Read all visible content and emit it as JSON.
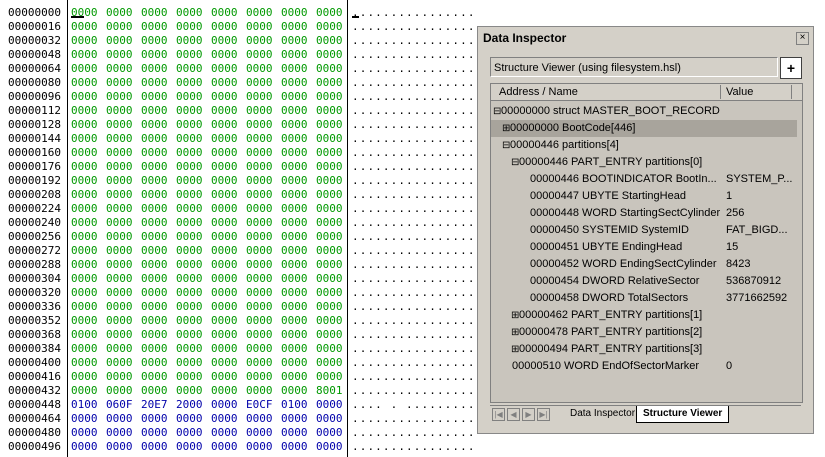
{
  "hex_view": {
    "rows": [
      {
        "offset": "00000000",
        "words": [
          "0000",
          "0000",
          "0000",
          "0000",
          "0000",
          "0000",
          "0000",
          "0000"
        ],
        "ascii": "................",
        "color": "g"
      },
      {
        "offset": "00000016",
        "words": [
          "0000",
          "0000",
          "0000",
          "0000",
          "0000",
          "0000",
          "0000",
          "0000"
        ],
        "ascii": "................",
        "color": "g"
      },
      {
        "offset": "00000032",
        "words": [
          "0000",
          "0000",
          "0000",
          "0000",
          "0000",
          "0000",
          "0000",
          "0000"
        ],
        "ascii": "................",
        "color": "g"
      },
      {
        "offset": "00000048",
        "words": [
          "0000",
          "0000",
          "0000",
          "0000",
          "0000",
          "0000",
          "0000",
          "0000"
        ],
        "ascii": "................",
        "color": "g"
      },
      {
        "offset": "00000064",
        "words": [
          "0000",
          "0000",
          "0000",
          "0000",
          "0000",
          "0000",
          "0000",
          "0000"
        ],
        "ascii": "................",
        "color": "g"
      },
      {
        "offset": "00000080",
        "words": [
          "0000",
          "0000",
          "0000",
          "0000",
          "0000",
          "0000",
          "0000",
          "0000"
        ],
        "ascii": "................",
        "color": "g"
      },
      {
        "offset": "00000096",
        "words": [
          "0000",
          "0000",
          "0000",
          "0000",
          "0000",
          "0000",
          "0000",
          "0000"
        ],
        "ascii": "................",
        "color": "g"
      },
      {
        "offset": "00000112",
        "words": [
          "0000",
          "0000",
          "0000",
          "0000",
          "0000",
          "0000",
          "0000",
          "0000"
        ],
        "ascii": "................",
        "color": "g"
      },
      {
        "offset": "00000128",
        "words": [
          "0000",
          "0000",
          "0000",
          "0000",
          "0000",
          "0000",
          "0000",
          "0000"
        ],
        "ascii": "................",
        "color": "g"
      },
      {
        "offset": "00000144",
        "words": [
          "0000",
          "0000",
          "0000",
          "0000",
          "0000",
          "0000",
          "0000",
          "0000"
        ],
        "ascii": "................",
        "color": "g"
      },
      {
        "offset": "00000160",
        "words": [
          "0000",
          "0000",
          "0000",
          "0000",
          "0000",
          "0000",
          "0000",
          "0000"
        ],
        "ascii": "................",
        "color": "g"
      },
      {
        "offset": "00000176",
        "words": [
          "0000",
          "0000",
          "0000",
          "0000",
          "0000",
          "0000",
          "0000",
          "0000"
        ],
        "ascii": "................",
        "color": "g"
      },
      {
        "offset": "00000192",
        "words": [
          "0000",
          "0000",
          "0000",
          "0000",
          "0000",
          "0000",
          "0000",
          "0000"
        ],
        "ascii": "................",
        "color": "g"
      },
      {
        "offset": "00000208",
        "words": [
          "0000",
          "0000",
          "0000",
          "0000",
          "0000",
          "0000",
          "0000",
          "0000"
        ],
        "ascii": "................",
        "color": "g"
      },
      {
        "offset": "00000224",
        "words": [
          "0000",
          "0000",
          "0000",
          "0000",
          "0000",
          "0000",
          "0000",
          "0000"
        ],
        "ascii": "................",
        "color": "g"
      },
      {
        "offset": "00000240",
        "words": [
          "0000",
          "0000",
          "0000",
          "0000",
          "0000",
          "0000",
          "0000",
          "0000"
        ],
        "ascii": "................",
        "color": "g"
      },
      {
        "offset": "00000256",
        "words": [
          "0000",
          "0000",
          "0000",
          "0000",
          "0000",
          "0000",
          "0000",
          "0000"
        ],
        "ascii": "................",
        "color": "g"
      },
      {
        "offset": "00000272",
        "words": [
          "0000",
          "0000",
          "0000",
          "0000",
          "0000",
          "0000",
          "0000",
          "0000"
        ],
        "ascii": "................",
        "color": "g"
      },
      {
        "offset": "00000288",
        "words": [
          "0000",
          "0000",
          "0000",
          "0000",
          "0000",
          "0000",
          "0000",
          "0000"
        ],
        "ascii": "................",
        "color": "g"
      },
      {
        "offset": "00000304",
        "words": [
          "0000",
          "0000",
          "0000",
          "0000",
          "0000",
          "0000",
          "0000",
          "0000"
        ],
        "ascii": "................",
        "color": "g"
      },
      {
        "offset": "00000320",
        "words": [
          "0000",
          "0000",
          "0000",
          "0000",
          "0000",
          "0000",
          "0000",
          "0000"
        ],
        "ascii": "................",
        "color": "g"
      },
      {
        "offset": "00000336",
        "words": [
          "0000",
          "0000",
          "0000",
          "0000",
          "0000",
          "0000",
          "0000",
          "0000"
        ],
        "ascii": "................",
        "color": "g"
      },
      {
        "offset": "00000352",
        "words": [
          "0000",
          "0000",
          "0000",
          "0000",
          "0000",
          "0000",
          "0000",
          "0000"
        ],
        "ascii": "................",
        "color": "g"
      },
      {
        "offset": "00000368",
        "words": [
          "0000",
          "0000",
          "0000",
          "0000",
          "0000",
          "0000",
          "0000",
          "0000"
        ],
        "ascii": "................",
        "color": "g"
      },
      {
        "offset": "00000384",
        "words": [
          "0000",
          "0000",
          "0000",
          "0000",
          "0000",
          "0000",
          "0000",
          "0000"
        ],
        "ascii": "................",
        "color": "g"
      },
      {
        "offset": "00000400",
        "words": [
          "0000",
          "0000",
          "0000",
          "0000",
          "0000",
          "0000",
          "0000",
          "0000"
        ],
        "ascii": "................",
        "color": "g"
      },
      {
        "offset": "00000416",
        "words": [
          "0000",
          "0000",
          "0000",
          "0000",
          "0000",
          "0000",
          "0000",
          "0000"
        ],
        "ascii": "................",
        "color": "g"
      },
      {
        "offset": "00000432",
        "words": [
          "0000",
          "0000",
          "0000",
          "0000",
          "0000",
          "0000",
          "0000",
          "8001"
        ],
        "ascii": "................",
        "color": "g"
      },
      {
        "offset": "00000448",
        "words": [
          "0100",
          "060F",
          "20E7",
          "2000",
          "0000",
          "E0CF",
          "0100",
          "0000"
        ],
        "ascii": ".... . .........",
        "color": "b"
      },
      {
        "offset": "00000464",
        "words": [
          "0000",
          "0000",
          "0000",
          "0000",
          "0000",
          "0000",
          "0000",
          "0000"
        ],
        "ascii": "................",
        "color": "b"
      },
      {
        "offset": "00000480",
        "words": [
          "0000",
          "0000",
          "0000",
          "0000",
          "0000",
          "0000",
          "0000",
          "0000"
        ],
        "ascii": "................",
        "color": "b"
      },
      {
        "offset": "00000496",
        "words": [
          "0000",
          "0000",
          "0000",
          "0000",
          "0000",
          "0000",
          "0000",
          "0000"
        ],
        "ascii": "................",
        "color": "b"
      }
    ]
  },
  "inspector": {
    "title": "Data Inspector",
    "close_glyph": "×",
    "structure_label": "Structure Viewer (using filesystem.hsl)",
    "add_glyph": "+",
    "col_name": "Address / Name",
    "col_value": "Value",
    "tree": [
      {
        "exp": "⊟",
        "name": "00000000 struct MASTER_BOOT_RECORD",
        "value": "",
        "indent": 0,
        "sel": false
      },
      {
        "exp": "⊞",
        "name": "00000000  BootCode[446]",
        "value": "",
        "indent": 1,
        "sel": true
      },
      {
        "exp": "⊟",
        "name": "00000446  partitions[4]",
        "value": "",
        "indent": 1,
        "sel": false
      },
      {
        "exp": "⊟",
        "name": "00000446 PART_ENTRY partitions[0]",
        "value": "",
        "indent": 2,
        "sel": false
      },
      {
        "exp": "",
        "name": "00000446 BOOTINDICATOR BootIn...",
        "value": "SYSTEM_P...",
        "indent": 3,
        "sel": false
      },
      {
        "exp": "",
        "name": "00000447 UBYTE StartingHead",
        "value": "1",
        "indent": 3,
        "sel": false
      },
      {
        "exp": "",
        "name": "00000448 WORD StartingSectCylinder",
        "value": "256",
        "indent": 3,
        "sel": false
      },
      {
        "exp": "",
        "name": "00000450 SYSTEMID SystemID",
        "value": "FAT_BIGD...",
        "indent": 3,
        "sel": false
      },
      {
        "exp": "",
        "name": "00000451 UBYTE EndingHead",
        "value": "15",
        "indent": 3,
        "sel": false
      },
      {
        "exp": "",
        "name": "00000452 WORD EndingSectCylinder",
        "value": "8423",
        "indent": 3,
        "sel": false
      },
      {
        "exp": "",
        "name": "00000454 DWORD RelativeSector",
        "value": "536870912",
        "indent": 3,
        "sel": false
      },
      {
        "exp": "",
        "name": "00000458 DWORD TotalSectors",
        "value": "3771662592",
        "indent": 3,
        "sel": false
      },
      {
        "exp": "⊞",
        "name": "00000462 PART_ENTRY partitions[1]",
        "value": "",
        "indent": 2,
        "sel": false
      },
      {
        "exp": "⊞",
        "name": "00000478 PART_ENTRY partitions[2]",
        "value": "",
        "indent": 2,
        "sel": false
      },
      {
        "exp": "⊞",
        "name": "00000494 PART_ENTRY partitions[3]",
        "value": "",
        "indent": 2,
        "sel": false
      },
      {
        "exp": "",
        "name": "00000510 WORD EndOfSectorMarker",
        "value": "0",
        "indent": 1,
        "sel": false
      }
    ],
    "tabs": [
      "Data Inspector",
      "Structure Viewer"
    ],
    "active_tab": "Structure Viewer"
  }
}
